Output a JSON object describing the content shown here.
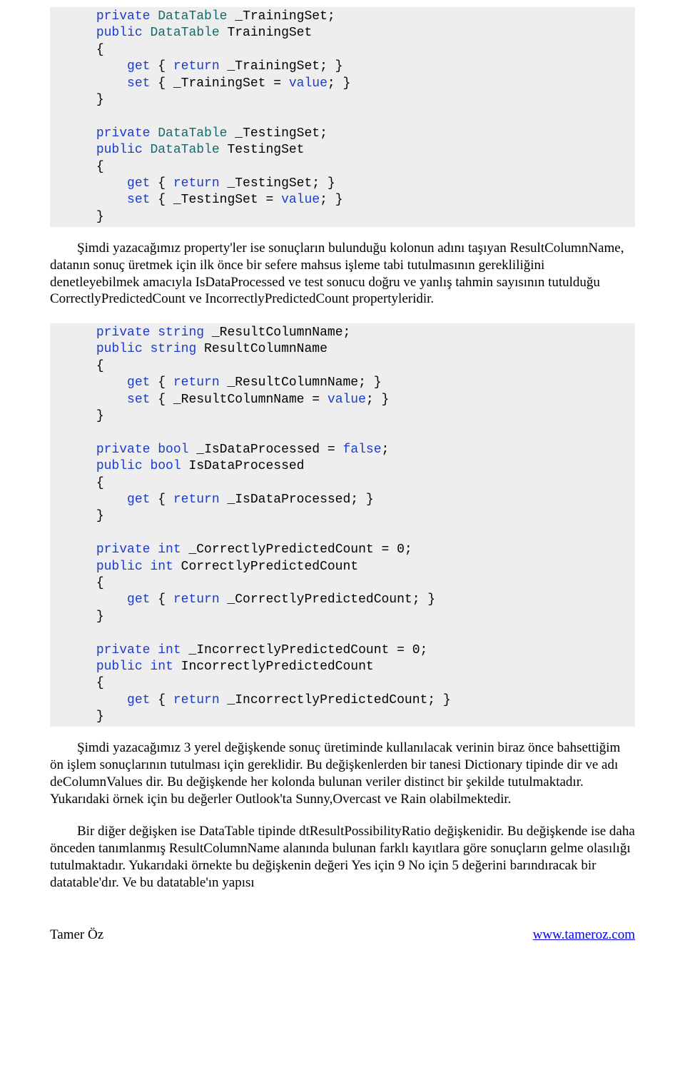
{
  "code1": {
    "l1a": "private",
    "l1b": " ",
    "l1c": "DataTable",
    "l1d": " _TrainingSet;",
    "l2a": "public",
    "l2b": " ",
    "l2c": "DataTable",
    "l2d": " TrainingSet",
    "l3": "{",
    "l4a": "    get",
    "l4b": " { ",
    "l4c": "return",
    "l4d": " _TrainingSet; }",
    "l5a": "    set",
    "l5b": " { _TrainingSet = ",
    "l5c": "value",
    "l5d": "; }",
    "l6": "}",
    "l7a": "private",
    "l7b": " ",
    "l7c": "DataTable",
    "l7d": " _TestingSet;",
    "l8a": "public",
    "l8b": " ",
    "l8c": "DataTable",
    "l8d": " TestingSet",
    "l9": "{",
    "l10a": "    get",
    "l10b": " { ",
    "l10c": "return",
    "l10d": " _TestingSet; }",
    "l11a": "    set",
    "l11b": " { _TestingSet = ",
    "l11c": "value",
    "l11d": "; }",
    "l12": "}"
  },
  "para1": "Şimdi yazacağımız property'ler ise sonuçların bulunduğu kolonun adını taşıyan ResultColumnName, datanın sonuç üretmek için ilk önce bir sefere mahsus işleme tabi tutulmasının gerekliliğini denetleyebilmek amacıyla IsDataProcessed ve test sonucu doğru ve yanlış tahmin sayısının tutulduğu CorrectlyPredictedCount ve IncorrectlyPredictedCount propertyleridir.",
  "code2": {
    "l1a": "private",
    "l1b": " ",
    "l1c": "string",
    "l1d": " _ResultColumnName;",
    "l2a": "public",
    "l2b": " ",
    "l2c": "string",
    "l2d": " ResultColumnName",
    "l3": "{",
    "l4a": "    get",
    "l4b": " { ",
    "l4c": "return",
    "l4d": " _ResultColumnName; }",
    "l5a": "    set",
    "l5b": " { _ResultColumnName = ",
    "l5c": "value",
    "l5d": "; }",
    "l6": "}",
    "l7a": "private",
    "l7b": " ",
    "l7c": "bool",
    "l7d": " _IsDataProcessed = ",
    "l7e": "false",
    "l7f": ";",
    "l8a": "public",
    "l8b": " ",
    "l8c": "bool",
    "l8d": " IsDataProcessed",
    "l9": "{",
    "l10a": "    get",
    "l10b": " { ",
    "l10c": "return",
    "l10d": " _IsDataProcessed; }",
    "l11": "}",
    "l12a": "private",
    "l12b": " ",
    "l12c": "int",
    "l12d": " _CorrectlyPredictedCount = 0;",
    "l13a": "public",
    "l13b": " ",
    "l13c": "int",
    "l13d": " CorrectlyPredictedCount",
    "l14": "{",
    "l15a": "    get",
    "l15b": " { ",
    "l15c": "return",
    "l15d": " _CorrectlyPredictedCount; }",
    "l16": "}",
    "l17a": "private",
    "l17b": " ",
    "l17c": "int",
    "l17d": " _IncorrectlyPredictedCount = 0;",
    "l18a": "public",
    "l18b": " ",
    "l18c": "int",
    "l18d": " IncorrectlyPredictedCount",
    "l19": "{",
    "l20a": "    get",
    "l20b": " { ",
    "l20c": "return",
    "l20d": " _IncorrectlyPredictedCount; }",
    "l21": "}"
  },
  "para2": "Şimdi yazacağımız 3 yerel değişkende sonuç üretiminde kullanılacak verinin biraz önce bahsettiğim ön işlem sonuçlarının tutulması için gereklidir. Bu değişkenlerden bir tanesi Dictionary tipinde dir ve adı deColumnValues dir. Bu değişkende her kolonda bulunan veriler distinct bir şekilde tutulmaktadır. Yukarıdaki örnek için bu değerler Outlook'ta Sunny,Overcast ve Rain olabilmektedir.",
  "para3": "Bir diğer değişken ise DataTable tipinde dtResultPossibilityRatio değişkenidir. Bu değişkende ise daha önceden tanımlanmış ResultColumnName alanında bulunan farklı kayıtlara göre sonuçların gelme olasılığı tutulmaktadır. Yukarıdaki örnekte bu değişkenin değeri Yes için 9 No için 5 değerini barındıracak bir datatable'dır. Ve bu datatable'ın yapısı",
  "footer": {
    "author": "Tamer Öz",
    "url": "www.tameroz.com"
  }
}
